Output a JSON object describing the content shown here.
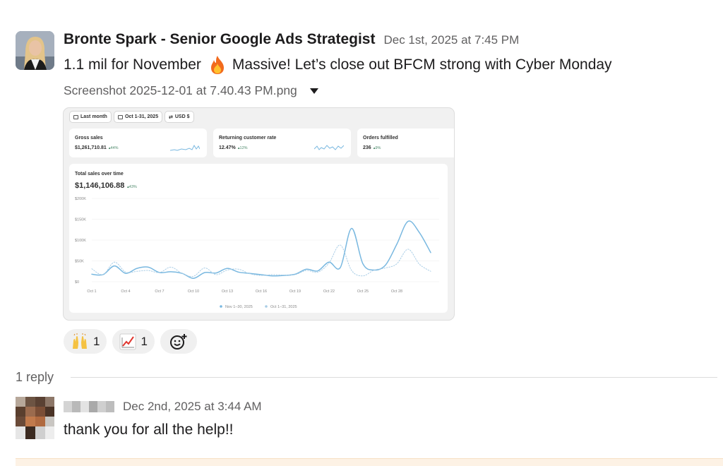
{
  "message": {
    "author": "Bronte Spark - Senior Google Ads Strategist",
    "timestamp": "Dec 1st, 2025 at 7:45 PM",
    "text_before_emoji": "1.1 mil for November",
    "emoji": "fire-emoji",
    "text_after_emoji": "Massive! Let’s close out BFCM strong with Cyber Monday",
    "attachment": {
      "filename": "Screenshot 2025-12-01 at 7.40.43 PM.png"
    }
  },
  "screenshot": {
    "filters": [
      "Last month",
      "Oct 1-31, 2025",
      "USD $"
    ],
    "cards": [
      {
        "label": "Gross sales",
        "value": "$1,261,710.81",
        "change": "▴44%"
      },
      {
        "label": "Returning customer rate",
        "value": "12.47%",
        "change": "▴12%"
      },
      {
        "label": "Orders fulfilled",
        "value": "236",
        "change": "▴9%"
      }
    ],
    "colors": {
      "current": "#79b8e0",
      "previous": "#a9cde6",
      "positive": "#4f8a6c"
    }
  },
  "chart_data": {
    "type": "line",
    "title": "Total sales over time",
    "total": "$1,146,106.88",
    "total_change": "▴43%",
    "ytick_labels": [
      "$200K",
      "$150K",
      "$100K",
      "$50K",
      "$0"
    ],
    "xtick_labels": [
      "Oct 1",
      "Oct 4",
      "Oct 7",
      "Oct 10",
      "Oct 13",
      "Oct 16",
      "Oct 19",
      "Oct 22",
      "Oct 25",
      "Oct 28"
    ],
    "ylim": [
      0,
      200000
    ],
    "x": [
      1,
      2,
      3,
      4,
      5,
      6,
      7,
      8,
      9,
      10,
      11,
      12,
      13,
      14,
      15,
      16,
      17,
      18,
      19,
      20,
      21,
      22,
      23,
      24,
      25,
      26,
      27,
      28,
      29,
      30,
      31
    ],
    "series": [
      {
        "name": "Nov 1–30, 2025",
        "style": "solid",
        "values": [
          18000,
          17000,
          38000,
          20000,
          32000,
          35000,
          22000,
          24000,
          20000,
          8000,
          22000,
          21000,
          32000,
          23000,
          20000,
          17000,
          14000,
          15000,
          18000,
          30000,
          26000,
          47000,
          34000,
          128000,
          43000,
          28000,
          40000,
          90000,
          145000,
          118000,
          70000
        ]
      },
      {
        "name": "Oct 1–31, 2025",
        "style": "dotted",
        "values": [
          31000,
          17000,
          47000,
          23000,
          25000,
          27000,
          22000,
          35000,
          20000,
          13000,
          33000,
          17000,
          28000,
          30000,
          19000,
          15000,
          17000,
          16000,
          17000,
          27000,
          23000,
          45000,
          88000,
          27000,
          14000,
          28000,
          33000,
          43000,
          78000,
          42000,
          25000
        ]
      }
    ],
    "legend": "bottom-center",
    "grid": true
  },
  "reactions": [
    {
      "icon": "raised-hands-emoji",
      "count": "1"
    },
    {
      "icon": "chart-increasing-emoji",
      "count": "1"
    }
  ],
  "thread": {
    "reply_count": "1 reply",
    "reply": {
      "timestamp": "Dec 2nd, 2025 at 3:44 AM",
      "text": "thank you for all the help!!"
    }
  }
}
